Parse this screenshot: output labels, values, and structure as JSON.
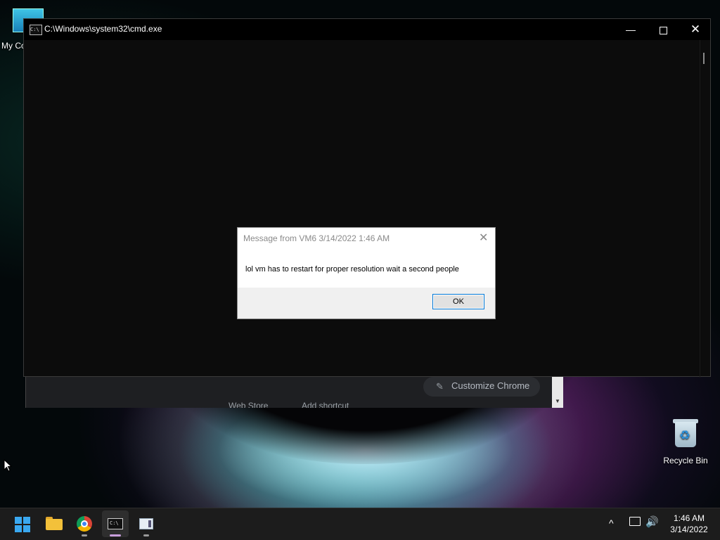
{
  "desktop": {
    "icons": [
      {
        "label": "My Co"
      },
      {
        "label": "Recycle Bin"
      }
    ]
  },
  "chrome_background": {
    "customize_label": "Customize Chrome",
    "shortcuts": [
      "Web Store",
      "Add shortcut"
    ]
  },
  "cmd_window": {
    "title": "C:\\Windows\\system32\\cmd.exe",
    "icon_text": "C:\\",
    "controls": {
      "minimize": "—",
      "close": "✕"
    }
  },
  "dialog": {
    "title": "Message from VM6 3/14/2022 1:46 AM",
    "message": "lol vm has to restart for proper resolution wait a second people",
    "ok_label": "OK",
    "close_glyph": "✕"
  },
  "taskbar": {
    "apps": [
      "start",
      "file-explorer",
      "chrome",
      "command-prompt",
      "vm-app"
    ],
    "tray_up_glyph": "^",
    "volume_glyph": "🔊",
    "clock_time": "1:46 AM",
    "clock_date": "3/14/2022"
  }
}
